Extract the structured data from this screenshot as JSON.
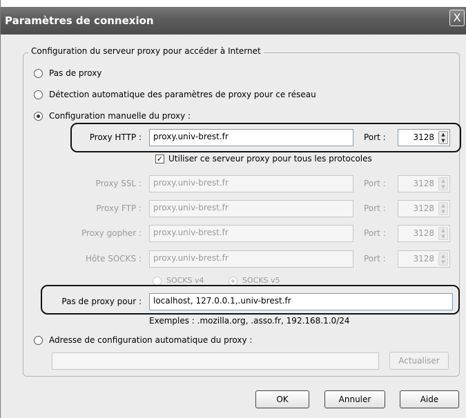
{
  "window": {
    "title": "Paramètres de connexion",
    "close_glyph": "X"
  },
  "group": {
    "legend": "Configuration du serveur proxy pour accéder à Internet"
  },
  "radios": {
    "no_proxy": "Pas de proxy",
    "auto_detect": "Détection automatique des paramètres de proxy pour ce réseau",
    "manual": "Configuration manuelle du proxy :",
    "auto_config_url": "Adresse de configuration automatique du proxy :"
  },
  "manual": {
    "http_label": "Proxy HTTP :",
    "http_value": "proxy.univ-brest.fr",
    "port_label": "Port :",
    "http_port": "3128",
    "use_for_all": "Utiliser ce serveur proxy pour tous les protocoles",
    "ssl_label": "Proxy SSL :",
    "ssl_value": "proxy.univ-brest.fr",
    "ssl_port": "3128",
    "ftp_label": "Proxy FTP :",
    "ftp_value": "proxy.univ-brest.fr",
    "ftp_port": "3128",
    "gopher_label": "Proxy gopher :",
    "gopher_value": "proxy.univ-brest.fr",
    "gopher_port": "3128",
    "socks_label": "Hôte SOCKS :",
    "socks_value": "proxy.univ-brest.fr",
    "socks_port": "3128",
    "socks_v4": "SOCKS v4",
    "socks_v5": "SOCKS v5",
    "no_proxy_label": "Pas de proxy pour :",
    "no_proxy_value": "localhost, 127.0.0.1,.univ-brest.fr",
    "examples": "Exemples : .mozilla.org, .asso.fr, 192.168.1.0/24"
  },
  "auto_config": {
    "url_value": "",
    "reload_button": "Actualiser"
  },
  "buttons": {
    "ok": "OK",
    "cancel": "Annuler",
    "help": "Aide"
  },
  "selected_option": "manual",
  "use_for_all_checked": true
}
